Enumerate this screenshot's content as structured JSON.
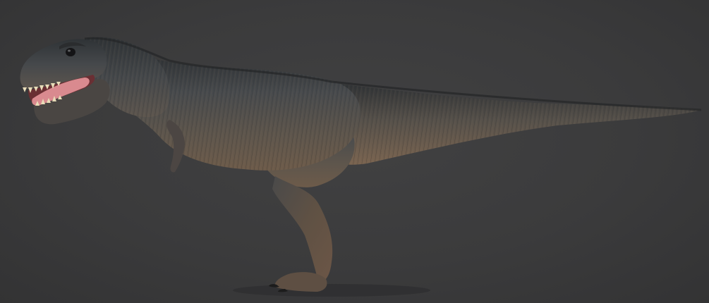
{
  "scene": {
    "subject": "tyrannosaurus-rex-3d-model",
    "background_color": "#3a3a3b",
    "colors": {
      "back_dark": "#2e3134",
      "skin_mid": "#4c4e50",
      "belly_brown": "#6e5c4c",
      "tail_brown": "#6a5a4a",
      "tongue_pink": "#d98a8f",
      "teeth_cream": "#e8dcb8"
    }
  }
}
